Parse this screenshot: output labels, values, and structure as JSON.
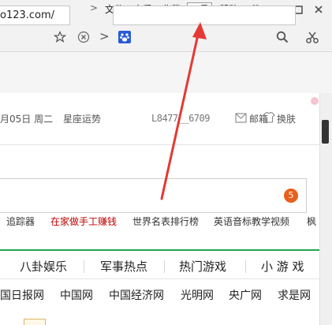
{
  "menubar": {
    "items": [
      "文件",
      "查看",
      "收藏",
      "工具",
      "帮助"
    ],
    "active": "工具"
  },
  "address_bar": {
    "url": "o123.com/"
  },
  "header": {
    "date": "月05日 周二",
    "astrology_link": "星座运势",
    "account": "L8477__6709",
    "mail_label": "邮箱",
    "skin_label": "换肤"
  },
  "search": {
    "badge_count": "5"
  },
  "hot_links": [
    "追踪器",
    "在家做手工赚钱",
    "世界名表排行榜",
    "英语音标教学视频",
    "枫"
  ],
  "category_tabs": [
    "八卦娱乐",
    "军事热点",
    "热门游戏",
    "小 游 戏"
  ],
  "site_links": [
    "国日报网",
    "中国网",
    "中国经济网",
    "光明网",
    "央广网",
    "求是网"
  ],
  "colors": {
    "accent_green": "#23a64f",
    "annotation_arrow": "#e53935",
    "promo_red": "#c00000",
    "badge_orange": "#e8601c"
  }
}
